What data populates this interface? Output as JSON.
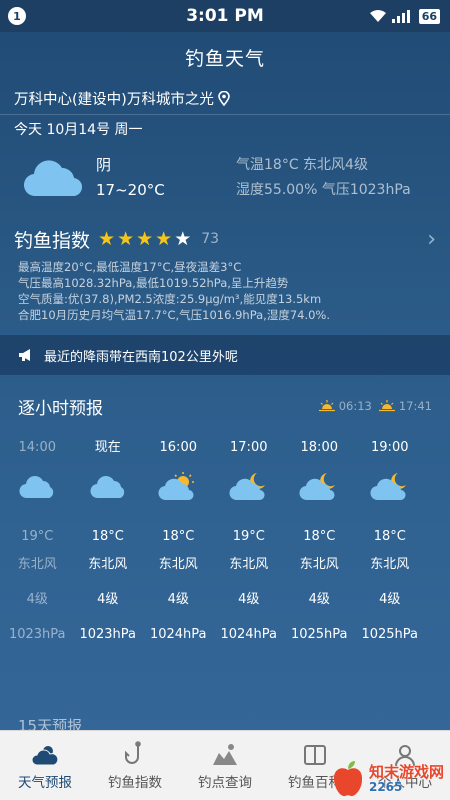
{
  "status_bar": {
    "notification_count": "1",
    "time": "3:01 PM",
    "battery": "66"
  },
  "header": {
    "title": "钓鱼天气",
    "location": "万科中心(建设中)万科城市之光"
  },
  "today": {
    "date": "今天 10月14号 周一",
    "condition": "阴",
    "temp_range": "17~20°C",
    "temp_wind": "气温18°C 东北风4级",
    "humidity_pressure": "湿度55.00% 气压1023hPa"
  },
  "fishing_index": {
    "title": "钓鱼指数",
    "stars": 4,
    "stars_max": 5,
    "score": "73",
    "details": [
      "最高温度20°C,最低温度17°C,昼夜温差3°C",
      "气压最高1028.32hPa,最低1019.52hPa,呈上升趋势",
      "空气质量:优(37.8),PM2.5浓度:25.9μg/m³,能见度13.5km",
      "合肥10月历史月均气温17.7°C,气压1016.9hPa,湿度74.0%."
    ]
  },
  "notice": {
    "text": "最近的降雨带在西南102公里外呢"
  },
  "hourly": {
    "title": "逐小时预报",
    "sunrise": "06:13",
    "sunset": "17:41",
    "hours": [
      {
        "time": "14:00",
        "icon": "cloud-icon",
        "temp": "19°C",
        "wind_dir": "东北风",
        "wind_level": "4级",
        "pressure": "1023hPa",
        "past": true
      },
      {
        "time": "现在",
        "icon": "cloud-icon",
        "temp": "18°C",
        "wind_dir": "东北风",
        "wind_level": "4级",
        "pressure": "1023hPa",
        "past": false
      },
      {
        "time": "16:00",
        "icon": "sun-cloud-icon",
        "temp": "18°C",
        "wind_dir": "东北风",
        "wind_level": "4级",
        "pressure": "1024hPa",
        "past": false
      },
      {
        "time": "17:00",
        "icon": "moon-cloud-icon",
        "temp": "19°C",
        "wind_dir": "东北风",
        "wind_level": "4级",
        "pressure": "1024hPa",
        "past": false
      },
      {
        "time": "18:00",
        "icon": "moon-cloud-icon",
        "temp": "18°C",
        "wind_dir": "东北风",
        "wind_level": "4级",
        "pressure": "1025hPa",
        "past": false
      },
      {
        "time": "19:00",
        "icon": "moon-cloud-icon",
        "temp": "18°C",
        "wind_dir": "东北风",
        "wind_level": "4级",
        "pressure": "1025hPa",
        "past": false
      }
    ]
  },
  "next_section": {
    "title": "15天预报"
  },
  "tabbar": {
    "items": [
      {
        "label": "天气预报",
        "icon": "weather-icon",
        "active": true
      },
      {
        "label": "钓鱼指数",
        "icon": "fishhook-icon",
        "active": false
      },
      {
        "label": "钓点查询",
        "icon": "map-spot-icon",
        "active": false
      },
      {
        "label": "钓鱼百科",
        "icon": "book-icon",
        "active": false
      },
      {
        "label": "个人中心",
        "icon": "user-icon",
        "active": false
      }
    ]
  },
  "watermark": {
    "text": "知末游戏网",
    "sub": "2265"
  },
  "colors": {
    "background_top": "#1f4a74",
    "star_on": "#f5c518",
    "sun": "#f5b82e",
    "moon": "#f5b82e",
    "cloud": "#7fc4f0",
    "tab_active": "#1f4a74"
  }
}
